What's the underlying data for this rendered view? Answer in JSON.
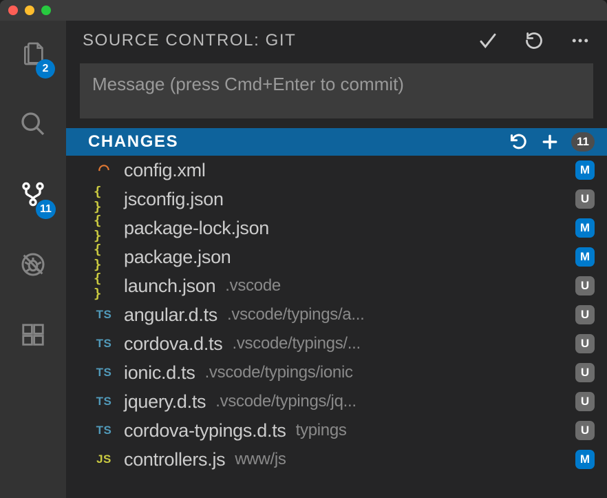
{
  "activityBar": {
    "items": [
      {
        "name": "explorer",
        "badge": "2"
      },
      {
        "name": "search",
        "badge": null
      },
      {
        "name": "scm",
        "badge": "11"
      },
      {
        "name": "debug",
        "badge": null
      },
      {
        "name": "extensions",
        "badge": null
      }
    ]
  },
  "panel": {
    "title": "SOURCE CONTROL: GIT",
    "commitPlaceholder": "Message (press Cmd+Enter to commit)"
  },
  "changes": {
    "title": "CHANGES",
    "count": "11",
    "files": [
      {
        "icon": "xml",
        "name": "config.xml",
        "path": "",
        "status": "M"
      },
      {
        "icon": "json",
        "name": "jsconfig.json",
        "path": "",
        "status": "U"
      },
      {
        "icon": "json",
        "name": "package-lock.json",
        "path": "",
        "status": "M"
      },
      {
        "icon": "json",
        "name": "package.json",
        "path": "",
        "status": "M"
      },
      {
        "icon": "json",
        "name": "launch.json",
        "path": ".vscode",
        "status": "U"
      },
      {
        "icon": "ts",
        "name": "angular.d.ts",
        "path": ".vscode/typings/a...",
        "status": "U"
      },
      {
        "icon": "ts",
        "name": "cordova.d.ts",
        "path": ".vscode/typings/...",
        "status": "U"
      },
      {
        "icon": "ts",
        "name": "ionic.d.ts",
        "path": ".vscode/typings/ionic",
        "status": "U"
      },
      {
        "icon": "ts",
        "name": "jquery.d.ts",
        "path": ".vscode/typings/jq...",
        "status": "U"
      },
      {
        "icon": "ts",
        "name": "cordova-typings.d.ts",
        "path": "typings",
        "status": "U"
      },
      {
        "icon": "js",
        "name": "controllers.js",
        "path": "www/js",
        "status": "M"
      }
    ]
  }
}
